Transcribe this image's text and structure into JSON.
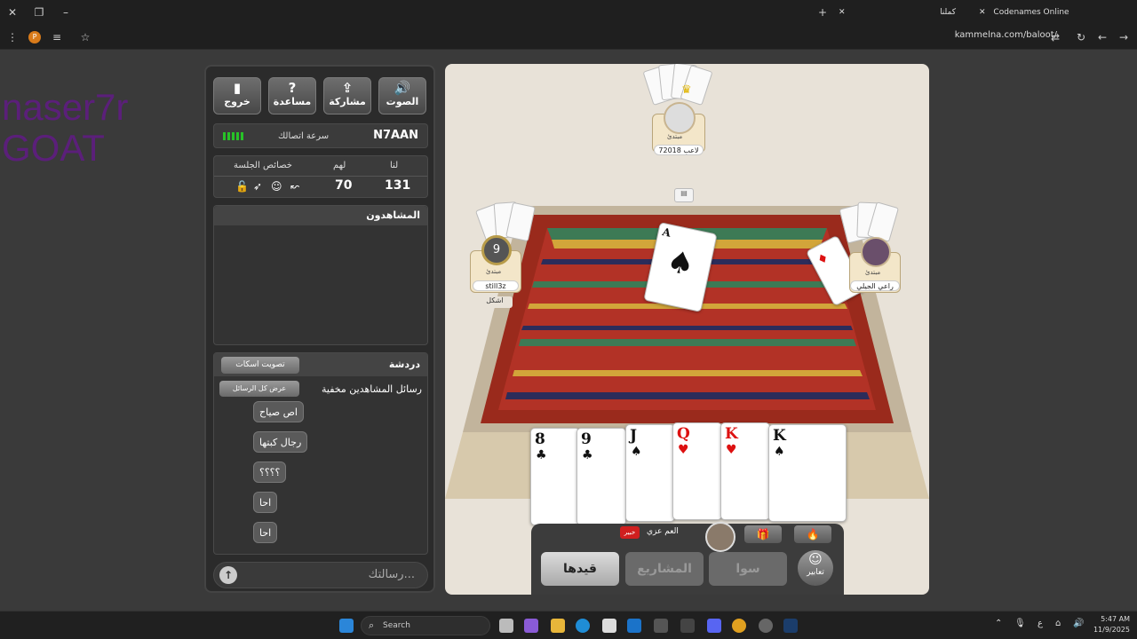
{
  "browser": {
    "tab1_title": "كملنا",
    "tab2_title": "Codenames Online",
    "url": "kammelna.com/baloot/",
    "profile_initial": "P"
  },
  "overlay": {
    "line1": "naser7r",
    "line2": "GOAT"
  },
  "panel": {
    "buttons": {
      "sound": "الصوت",
      "share": "مشاركة",
      "help": "مساعدة",
      "exit": "خروج"
    },
    "connection": {
      "username": "N7AAN",
      "label": "سرعة اتصالك"
    },
    "score": {
      "us_label": "لنا",
      "them_label": "لهم",
      "props_label": "خصائص الجلسة",
      "us_value": "131",
      "them_value": "70"
    },
    "spectators_title": "المشاهدون",
    "chat": {
      "title": "دردشة",
      "mute_button": "تصويت اسكات",
      "hidden_label": "رسائل المشاهدين مخفية",
      "show_all_button": "عرض كل الرسائل",
      "messages": [
        "اص صياح",
        "رجال كبتها",
        "؟؟؟؟",
        "احا",
        "احا"
      ],
      "input_placeholder": "رسالتك..."
    }
  },
  "game": {
    "top_player": {
      "rank": "مبتدئ",
      "name": "لاعب 72018"
    },
    "left_player": {
      "rank": "مبتدئ",
      "name": "still3z",
      "badge": "9",
      "extra": "اشكل"
    },
    "right_player": {
      "rank": "مبتدئ",
      "name": "راعي الجيلي"
    },
    "center_card": {
      "rank": "A",
      "suit": "♠"
    },
    "hand": [
      {
        "rank": "8",
        "suit": "♣",
        "color": "#111111"
      },
      {
        "rank": "9",
        "suit": "♣",
        "color": "#111111"
      },
      {
        "rank": "J",
        "suit": "♠",
        "color": "#111111"
      },
      {
        "rank": "Q",
        "suit": "♥",
        "color": "#dd1111"
      },
      {
        "rank": "K",
        "suit": "♥",
        "color": "#dd1111"
      },
      {
        "rank": "K",
        "suit": "♠",
        "color": "#111111"
      }
    ],
    "bottom": {
      "my_name": "العم عزي",
      "badge": "خبير",
      "buttons": {
        "qaydha": "قيدها",
        "projects": "المشاريع",
        "sawa": "سوا",
        "emotes": "تعابير"
      }
    }
  },
  "taskbar": {
    "search_placeholder": "Search",
    "time": "5:47 AM",
    "date": "11/9/2025",
    "lang": "ع"
  },
  "colors": {
    "panel_bg": "#2b2b2b",
    "accent_green": "#27c227",
    "overlay_text": "#5b1f7a"
  }
}
